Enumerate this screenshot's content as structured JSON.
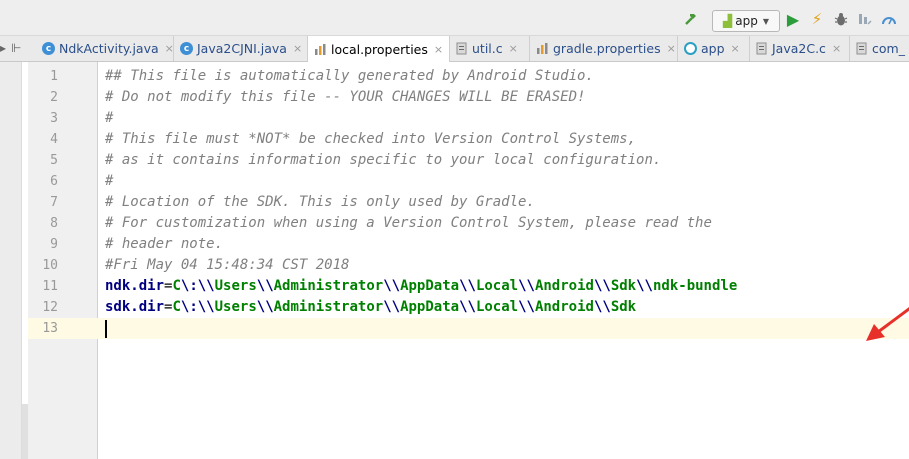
{
  "toolbar": {
    "build_icon": "hammer-icon",
    "run_config": "app",
    "run_icon": "run-icon",
    "apply_changes_icon": "lightning-icon",
    "debug_icon": "bug-icon",
    "coverage_icon": "coverage-icon",
    "profiler_icon": "gauge-icon"
  },
  "tabs": [
    {
      "label": "NdkActivity.java",
      "icon": "c",
      "active": false
    },
    {
      "label": "Java2CJNI.java",
      "icon": "c",
      "active": false
    },
    {
      "label": "local.properties",
      "icon": "",
      "active": true
    },
    {
      "label": "util.c",
      "icon": "",
      "active": false
    },
    {
      "label": "gradle.properties",
      "icon": "",
      "active": false
    },
    {
      "label": "app",
      "icon": "",
      "active": false
    },
    {
      "label": "Java2C.c",
      "icon": "",
      "active": false
    },
    {
      "label": "com_",
      "icon": "",
      "active": false
    }
  ],
  "tab_close_glyph": "×",
  "editor": {
    "line_numbers": [
      "1",
      "2",
      "3",
      "4",
      "5",
      "6",
      "7",
      "8",
      "9",
      "10",
      "11",
      "12",
      "13"
    ],
    "comments": [
      "## This file is automatically generated by Android Studio.",
      "# Do not modify this file -- YOUR CHANGES WILL BE ERASED!",
      "#",
      "# This file must *NOT* be checked into Version Control Systems,",
      "# as it contains information specific to your local configuration.",
      "#",
      "# Location of the SDK. This is only used by Gradle.",
      "# For customization when using a Version Control System, please read the",
      "# header note.",
      "#Fri May 04 15:48:34 CST 2018"
    ],
    "ndk_key": "ndk.dir",
    "ndk_value_parts": [
      "C",
      "\\:",
      "\\\\",
      "Users",
      "\\\\",
      "Administrator",
      "\\\\",
      "AppData",
      "\\\\",
      "Local",
      "\\\\",
      "Android",
      "\\\\",
      "Sdk",
      "\\\\",
      "ndk-bundle"
    ],
    "sdk_key": "sdk.dir",
    "sdk_value_parts": [
      "C",
      "\\:",
      "\\\\",
      "Users",
      "\\\\",
      "Administrator",
      "\\\\",
      "AppData",
      "\\\\",
      "Local",
      "\\\\",
      "Android",
      "\\\\",
      "Sdk"
    ],
    "equals": "=",
    "current_line": "13"
  },
  "colors": {
    "comment": "#808080",
    "key": "#000080",
    "value": "#008000",
    "annotation_arrow": "#e8302a",
    "current_line_bg": "#fffae3"
  }
}
